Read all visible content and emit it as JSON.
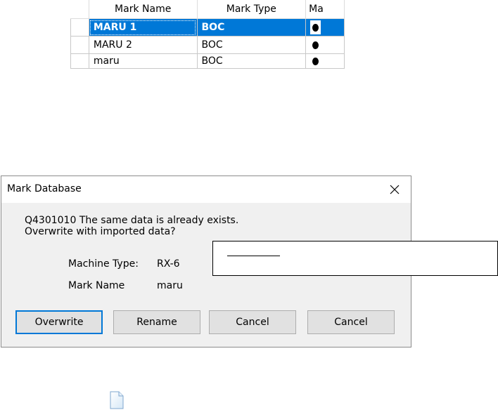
{
  "grid": {
    "columns": [
      "Mark Name",
      "Mark Type",
      "Ma"
    ],
    "rows": [
      {
        "name": "MARU 1",
        "type": "BOC",
        "mark": "filled-dot",
        "selected": true
      },
      {
        "name": "MARU 2",
        "type": "BOC",
        "mark": "filled-dot",
        "selected": false
      },
      {
        "name": "maru",
        "type": "BOC",
        "mark": "filled-dot",
        "selected": false
      }
    ],
    "selection_color": "#0078d7"
  },
  "dialog": {
    "title": "Mark Database",
    "message_line1": "Q4301010 The same data is already exists.",
    "message_line2": "Overwrite with imported data?",
    "machine_type_label": "Machine Type:",
    "machine_type_value": "RX-6",
    "mark_name_label": "Mark Name",
    "mark_name_value": "maru",
    "buttons": {
      "overwrite": "Overwrite",
      "rename": "Rename",
      "cancel1": "Cancel",
      "cancel2": "Cancel"
    },
    "close_icon": "close-icon"
  },
  "overlay": {
    "icon": "redaction-box"
  },
  "file_icon": "document-icon"
}
